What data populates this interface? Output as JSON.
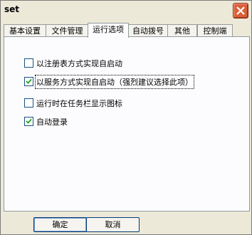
{
  "window": {
    "title": "set"
  },
  "tabs": [
    "基本设置",
    "文件管理",
    "运行选项",
    "自动拨号",
    "其他",
    "控制端"
  ],
  "options": [
    {
      "label": "以注册表方式实现自启动",
      "checked": false
    },
    {
      "label": "以服务方式实现自启动（强烈建议选择此项）",
      "checked": true
    },
    {
      "label": "运行时在任务栏显示图标",
      "checked": false
    },
    {
      "label": "自动登录",
      "checked": true
    }
  ],
  "buttons": {
    "ok": "确定",
    "cancel": "取消"
  }
}
